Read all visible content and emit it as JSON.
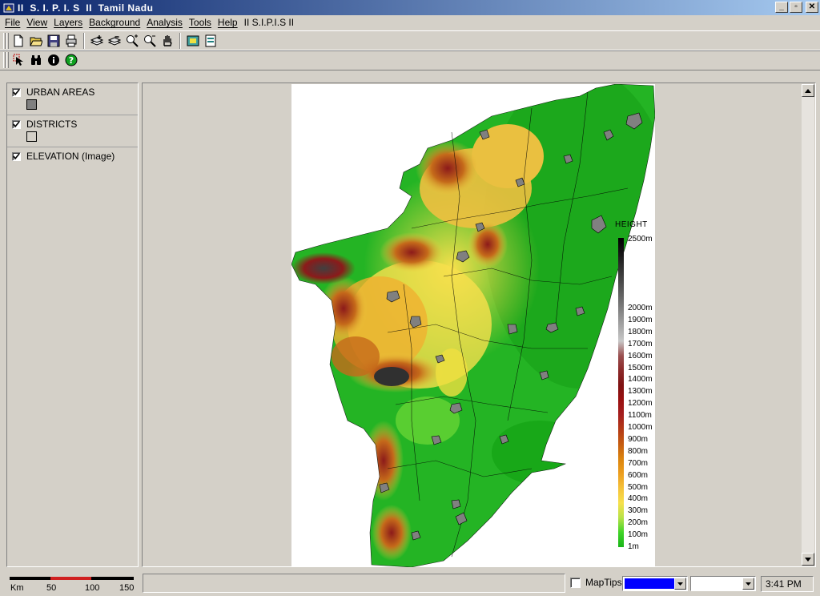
{
  "window": {
    "title": "II  S. I. P. I. S  II  Tamil Nadu",
    "minimize": "_",
    "maximize": "▫",
    "close": "✕"
  },
  "menu": [
    "File",
    "View",
    "Layers",
    "Background",
    "Analysis",
    "Tools",
    "Help",
    "II S.I.P.I.S II"
  ],
  "toolbar1": [
    "new-file-icon",
    "open-folder-icon",
    "save-icon",
    "print-icon",
    "add-layer-icon",
    "remove-layer-icon",
    "zoom-in-icon",
    "zoom-out-icon",
    "pan-hand-icon",
    "map-extent-icon",
    "properties-icon"
  ],
  "toolbar2": [
    "select-pointer-icon",
    "binoculars-find-icon",
    "identify-info-icon",
    "help-icon"
  ],
  "layers": [
    {
      "label": "URBAN AREAS",
      "checked": true,
      "swatch": "#808080"
    },
    {
      "label": "DISTRICTS",
      "checked": true,
      "swatch": "#d4d0c8"
    },
    {
      "label": "ELEVATION (Image)",
      "checked": true
    }
  ],
  "map_legend": {
    "title": "HEIGHT",
    "entries": [
      "2500m",
      "2000m",
      "1900m",
      "1800m",
      "1700m",
      "1600m",
      "1500m",
      "1400m",
      "1300m",
      "1200m",
      "1100m",
      "1000m",
      "900m",
      "800m",
      "700m",
      "600m",
      "500m",
      "400m",
      "300m",
      "200m",
      "100m",
      "1m"
    ],
    "colors": [
      "#000000",
      "#141414",
      "#303030",
      "#4a4a4a",
      "#666666",
      "#858585",
      "#a6a6a6",
      "#c8c8c8",
      "#9a5050",
      "#8c2a2a",
      "#7e1212",
      "#9a1010",
      "#a41e1e",
      "#b43a16",
      "#c55c10",
      "#db840e",
      "#ec9e1e",
      "#f5c23a",
      "#f7e04c",
      "#b8e248",
      "#40d428",
      "#18b418"
    ]
  },
  "scalebar": {
    "unit": "Km",
    "labels": [
      "50",
      "100",
      "150"
    ]
  },
  "status": {
    "maptips_label": "MapTips",
    "maptips_checked": false,
    "color_combo": "#0000ff",
    "time": "3:41 PM"
  }
}
